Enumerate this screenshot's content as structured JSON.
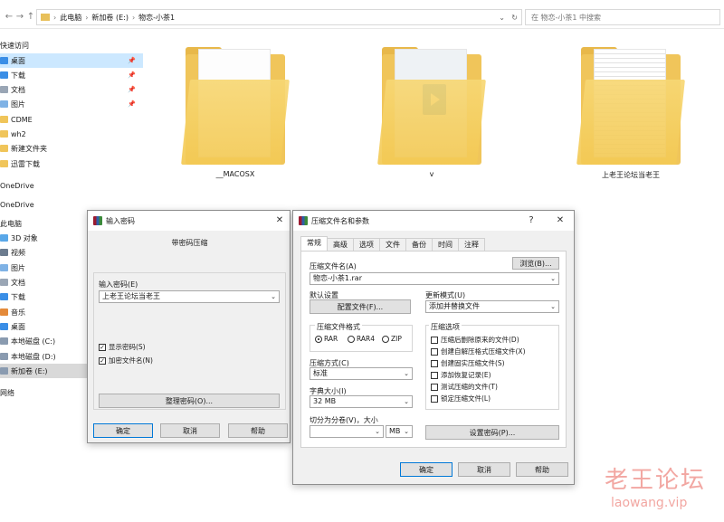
{
  "explorer": {
    "path": [
      "此电脑",
      "新加卷 (E:)",
      "物恋-小茶1"
    ],
    "search_placeholder": "在 物恋-小茶1 中搜索",
    "nav": {
      "back": "←",
      "forward": "→",
      "up": "↑",
      "dropdown": "⌄",
      "refresh": "↻",
      "sep": "›"
    },
    "quick_access_header": "快速访问",
    "quick_items": [
      {
        "label": "桌面",
        "pinned": true
      },
      {
        "label": "下载",
        "pinned": true
      },
      {
        "label": "文档",
        "pinned": true
      },
      {
        "label": "图片",
        "pinned": true
      },
      {
        "label": "CDME",
        "pinned": false
      },
      {
        "label": "wh2",
        "pinned": false
      },
      {
        "label": "新建文件夹",
        "pinned": false
      },
      {
        "label": "迅雷下载",
        "pinned": false
      }
    ],
    "pin_glyph": "📌",
    "onedrive1": "OneDrive",
    "onedrive2": "OneDrive",
    "this_pc": "此电脑",
    "pc_items": [
      "3D 对象",
      "视频",
      "图片",
      "文档",
      "下载",
      "音乐",
      "桌面",
      "本地磁盘 (C:)",
      "本地磁盘 (D:)",
      "新加卷 (E:)"
    ],
    "network": "网络",
    "folders": [
      "__MACOSX",
      "v",
      "上老王论坛当老王"
    ]
  },
  "password_dialog": {
    "title": "输入密码",
    "heading": "带密码压缩",
    "label": "输入密码(E)",
    "value": "上老王论坛当老王",
    "show_password": "显示密码(S)",
    "encrypt_names": "加密文件名(N)",
    "organize": "整理密码(O)...",
    "ok": "确定",
    "cancel": "取消",
    "help": "帮助"
  },
  "archive_dialog": {
    "title": "压缩文件名和参数",
    "help_glyph": "?",
    "close_glyph": "✕",
    "tabs": [
      "常规",
      "高级",
      "选项",
      "文件",
      "备份",
      "时间",
      "注释"
    ],
    "archive_name_label": "压缩文件名(A)",
    "browse": "浏览(B)...",
    "archive_name": "物恋-小茶1.rar",
    "default_settings": "默认设置",
    "profiles": "配置文件(F)...",
    "update_mode_label": "更新模式(U)",
    "update_mode": "添加并替换文件",
    "format_label": "压缩文件格式",
    "formats": [
      "RAR",
      "RAR4",
      "ZIP"
    ],
    "options_label": "压缩选项",
    "options": [
      "压缩后删除原来的文件(D)",
      "创建自解压格式压缩文件(X)",
      "创建固实压缩文件(S)",
      "添加恢复记录(E)",
      "测试压缩的文件(T)",
      "锁定压缩文件(L)"
    ],
    "method_label": "压缩方式(C)",
    "method": "标准",
    "dict_label": "字典大小(I)",
    "dict": "32 MB",
    "split_label": "切分为分卷(V)，大小",
    "split_unit": "MB",
    "set_password": "设置密码(P)...",
    "ok": "确定",
    "cancel": "取消",
    "help": "帮助"
  },
  "watermark": {
    "cn": "老王论坛",
    "en": "laowang.vip"
  }
}
